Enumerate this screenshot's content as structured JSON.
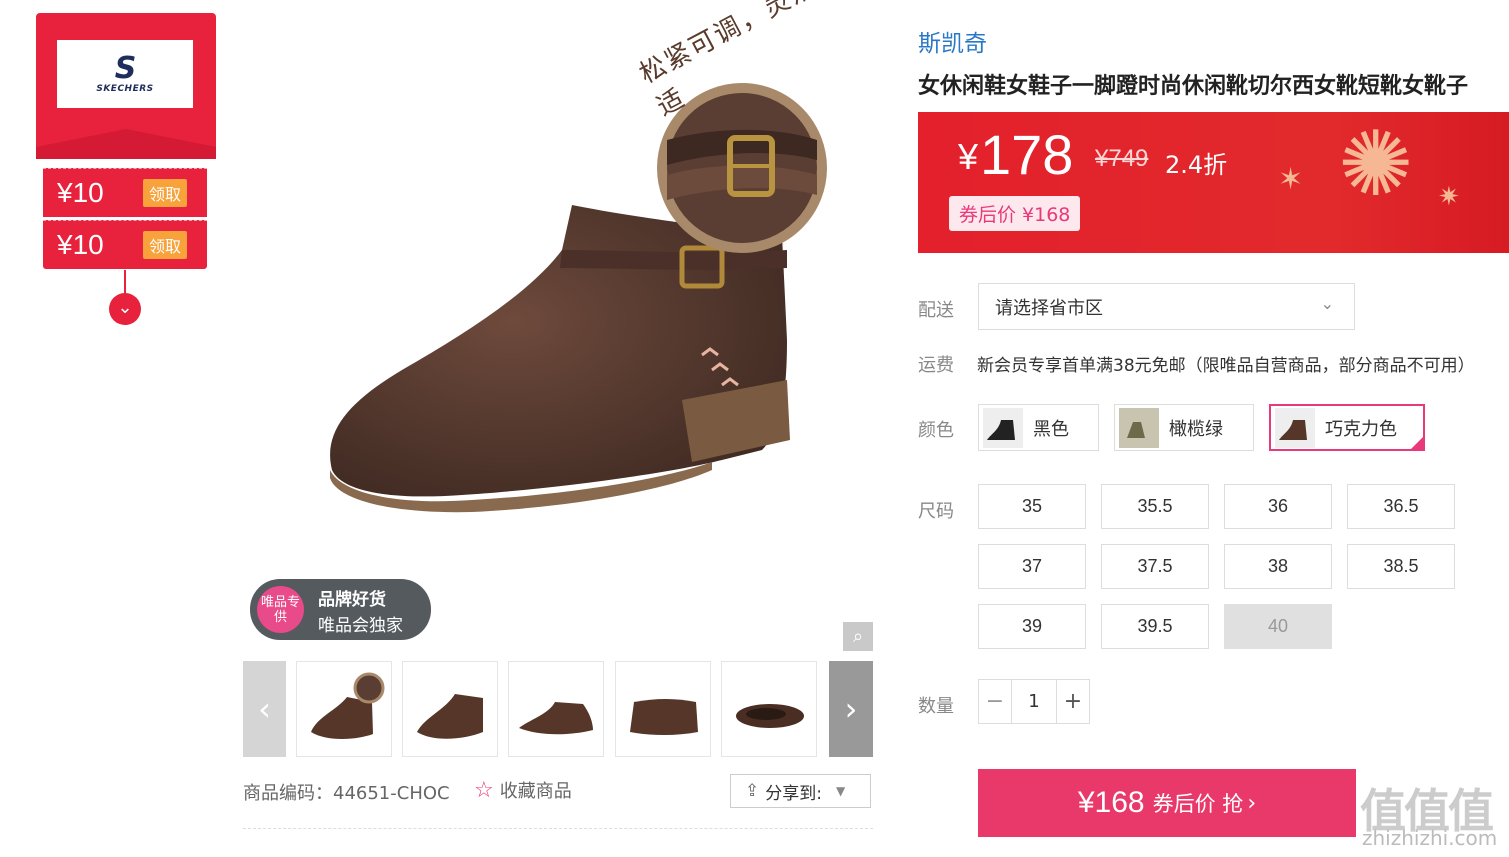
{
  "sidebar": {
    "brand_logo": {
      "mark": "S",
      "text": "SKECHERS"
    },
    "coupons": [
      {
        "amount": "¥10",
        "action": "领取"
      },
      {
        "amount": "¥10",
        "action": "领取"
      }
    ],
    "toggle_icon": "chevron-down-icon"
  },
  "gallery": {
    "main_image_caption": "松紧可调，灵活舒适",
    "badge": {
      "circle": "唯品专供",
      "line1": "品牌好货",
      "line2": "唯品会独家"
    },
    "thumbnails": [
      "thumb-1",
      "thumb-2",
      "thumb-3",
      "thumb-4",
      "thumb-5"
    ],
    "sku_code": "商品编码：44651-CHOC",
    "favorite": "收藏商品",
    "share": "分享到:"
  },
  "product": {
    "brand": "斯凯奇",
    "title": "女休闲鞋女鞋子一脚蹬时尚休闲靴切尔西女靴短靴女靴子",
    "price_symbol": "¥",
    "price": "178",
    "original_price": "¥749",
    "discount": "2.4折",
    "after_coupon": "券后价 ¥168"
  },
  "delivery": {
    "label": "配送",
    "placeholder": "请选择省市区"
  },
  "freight": {
    "label": "运费",
    "text": "新会员专享首单满38元免邮（限唯品自营商品，部分商品不可用）"
  },
  "colors": {
    "label": "颜色",
    "options": [
      {
        "name": "黑色",
        "selected": false
      },
      {
        "name": "橄榄绿",
        "selected": false
      },
      {
        "name": "巧克力色",
        "selected": true
      }
    ]
  },
  "sizes": {
    "label": "尺码",
    "options": [
      {
        "v": "35"
      },
      {
        "v": "35.5"
      },
      {
        "v": "36"
      },
      {
        "v": "36.5"
      },
      {
        "v": "37"
      },
      {
        "v": "37.5"
      },
      {
        "v": "38"
      },
      {
        "v": "38.5"
      },
      {
        "v": "39"
      },
      {
        "v": "39.5"
      },
      {
        "v": "40",
        "disabled": true
      }
    ]
  },
  "quantity": {
    "label": "数量",
    "value": "1",
    "minus": "−",
    "plus": "+"
  },
  "buy_button": {
    "price": "¥168",
    "text": "券后价 抢"
  },
  "watermark": {
    "text": "值值值",
    "url_text": "zhizhizhi.com"
  },
  "colors_theme": {
    "accent": "#e8397a",
    "price_red": "#e3202c",
    "brand_blue": "#2a78c5"
  }
}
